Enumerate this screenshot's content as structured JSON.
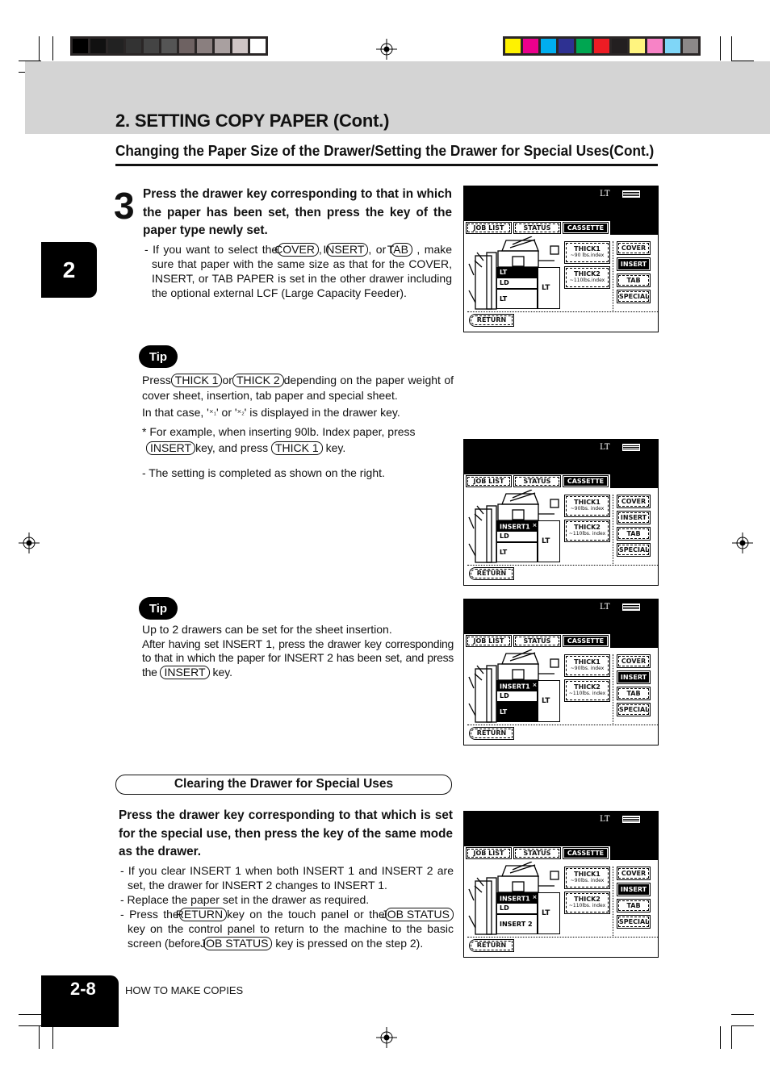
{
  "print_marks": {
    "gray_swatches": [
      "#000000",
      "#111111",
      "#222222",
      "#333333",
      "#444444",
      "#555555",
      "#6e6262",
      "#8a7f7f",
      "#a9a0a0",
      "#cfc5c5",
      "#ffffff"
    ],
    "color_swatches": [
      "#fff200",
      "#ec008c",
      "#00aeef",
      "#2e3192",
      "#00a651",
      "#ed1c24",
      "#231f20",
      "#fff47f",
      "#f783c6",
      "#7fd6f7",
      "#8c8888"
    ]
  },
  "header": {
    "title": "2. SETTING COPY PAPER (Cont.)",
    "subtitle": "Changing the Paper Size of the Drawer/Setting the Drawer for Special Uses(Cont.)"
  },
  "chapter_tab": "2",
  "step3": {
    "number": "3",
    "instruction": "Press the drawer key corresponding to that in which the paper has been set, then press the key of the paper type newly set.",
    "note": {
      "t1": "- If you want to select the",
      "k1": "COVER",
      "t2": ",",
      "k2": "INSERT",
      "t3": ", or",
      "k3": "TAB",
      "t4": ", make sure that paper with the same size as that for the COVER, INSERT, or TAB PAPER is set in the other drawer including the optional external LCF (Large Capacity Feeder)."
    }
  },
  "tip1": {
    "badge": "Tip",
    "t1": "Press",
    "k1": "THICK 1",
    "t2": "or",
    "k2": "THICK 2",
    "t3": "depending on the paper weight of cover sheet, insertion, tab paper and special sheet.",
    "t4": "In that case, '",
    "s1": "1",
    "t5": "' or '",
    "s2": "2",
    "t6": "' is displayed in the drawer key.",
    "t7": "* For example, when inserting 90lb. Index paper, press",
    "k3": "INSERT",
    "t8": "key, and press",
    "k4": "THICK 1",
    "t9": "key.",
    "t10": "- The setting is completed as shown on the right."
  },
  "tip2": {
    "badge": "Tip",
    "t1": "Up to 2 drawers can be set for the sheet insertion.",
    "t2": "After having set INSERT 1,  press the drawer key corresponding to that in which the paper for INSERT 2 has been set, and press the",
    "k1": "INSERT",
    "t3": "key."
  },
  "clearing": {
    "section_title": "Clearing the Drawer for Special Uses",
    "instruction": "Press the drawer key corresponding to that which is set for the special use, then press the key of the same mode as the drawer.",
    "n1": "- If you clear INSERT 1 when both INSERT 1 and INSERT 2 are set, the drawer for INSERT 2 changes to INSERT 1.",
    "n2": "- Replace the paper set in the drawer as required.",
    "n3a": "- Press the",
    "k1": "RETURN",
    "n3b": "key on the touch panel or the",
    "k2": "JOB STATUS",
    "n3c": "key on the control panel to return to the machine to the basic screen (before",
    "k3": "JOB STATUS",
    "n3d": "key is pressed on the step 2)."
  },
  "panels": [
    {
      "size": "LT",
      "tabs": [
        "JOB LIST",
        "STATUS",
        "CASSETTE"
      ],
      "active_tab": "CASSETTE",
      "drawers": [
        {
          "label": "LT",
          "selected": true
        },
        {
          "label": "LD",
          "selected": false
        },
        {
          "label": "LT",
          "selected": false
        }
      ],
      "lcf": "LT",
      "thick": [
        {
          "label": "THICK1",
          "sub": "~90 lbs.index"
        },
        {
          "label": "THICK2",
          "sub": "~110lbs.index"
        }
      ],
      "modes": [
        "COVER",
        "INSERT",
        "TAB",
        "SPECIAL"
      ],
      "active_mode": "INSERT",
      "return": "RETURN"
    },
    {
      "size": "LT",
      "tabs": [
        "JOB LIST",
        "STATUS",
        "CASSETTE"
      ],
      "active_tab": "CASSETTE",
      "drawers": [
        {
          "label": "INSERT1",
          "mark": "1",
          "selected": true
        },
        {
          "label": "LD",
          "selected": false
        },
        {
          "label": "LT",
          "selected": false
        }
      ],
      "lcf": "LT",
      "thick": [
        {
          "label": "THICK1",
          "sub": "~90lbs. index"
        },
        {
          "label": "THICK2",
          "sub": "~110lbs. index"
        }
      ],
      "modes": [
        "COVER",
        "INSERT",
        "TAB",
        "SPECIAL"
      ],
      "active_mode": "",
      "return": "RETURN"
    },
    {
      "size": "LT",
      "tabs": [
        "JOB LIST",
        "STATUS",
        "CASSETTE"
      ],
      "active_tab": "CASSETTE",
      "drawers": [
        {
          "label": "INSERT1",
          "mark": "1",
          "selected": true
        },
        {
          "label": "LD",
          "selected": false
        },
        {
          "label": "LT",
          "selected": true
        }
      ],
      "lcf": "LT",
      "thick": [
        {
          "label": "THICK1",
          "sub": "~90lbs. index"
        },
        {
          "label": "THICK2",
          "sub": "~110lbs. index"
        }
      ],
      "modes": [
        "COVER",
        "INSERT",
        "TAB",
        "SPECIAL"
      ],
      "active_mode": "INSERT",
      "return": "RETURN"
    },
    {
      "size": "LT",
      "tabs": [
        "JOB LIST",
        "STATUS",
        "CASSETTE"
      ],
      "active_tab": "CASSETTE",
      "drawers": [
        {
          "label": "INSERT1",
          "mark": "1",
          "selected": true
        },
        {
          "label": "LD",
          "selected": false
        },
        {
          "label": "INSERT 2",
          "selected": false
        }
      ],
      "lcf": "LT",
      "thick": [
        {
          "label": "THICK1",
          "sub": "~90lbs. index"
        },
        {
          "label": "THICK2",
          "sub": "~110lbs. index"
        }
      ],
      "modes": [
        "COVER",
        "INSERT",
        "TAB",
        "SPECIAL"
      ],
      "active_mode": "INSERT",
      "return": "RETURN"
    }
  ],
  "footer": {
    "page": "2-8",
    "label": "HOW TO MAKE COPIES"
  }
}
